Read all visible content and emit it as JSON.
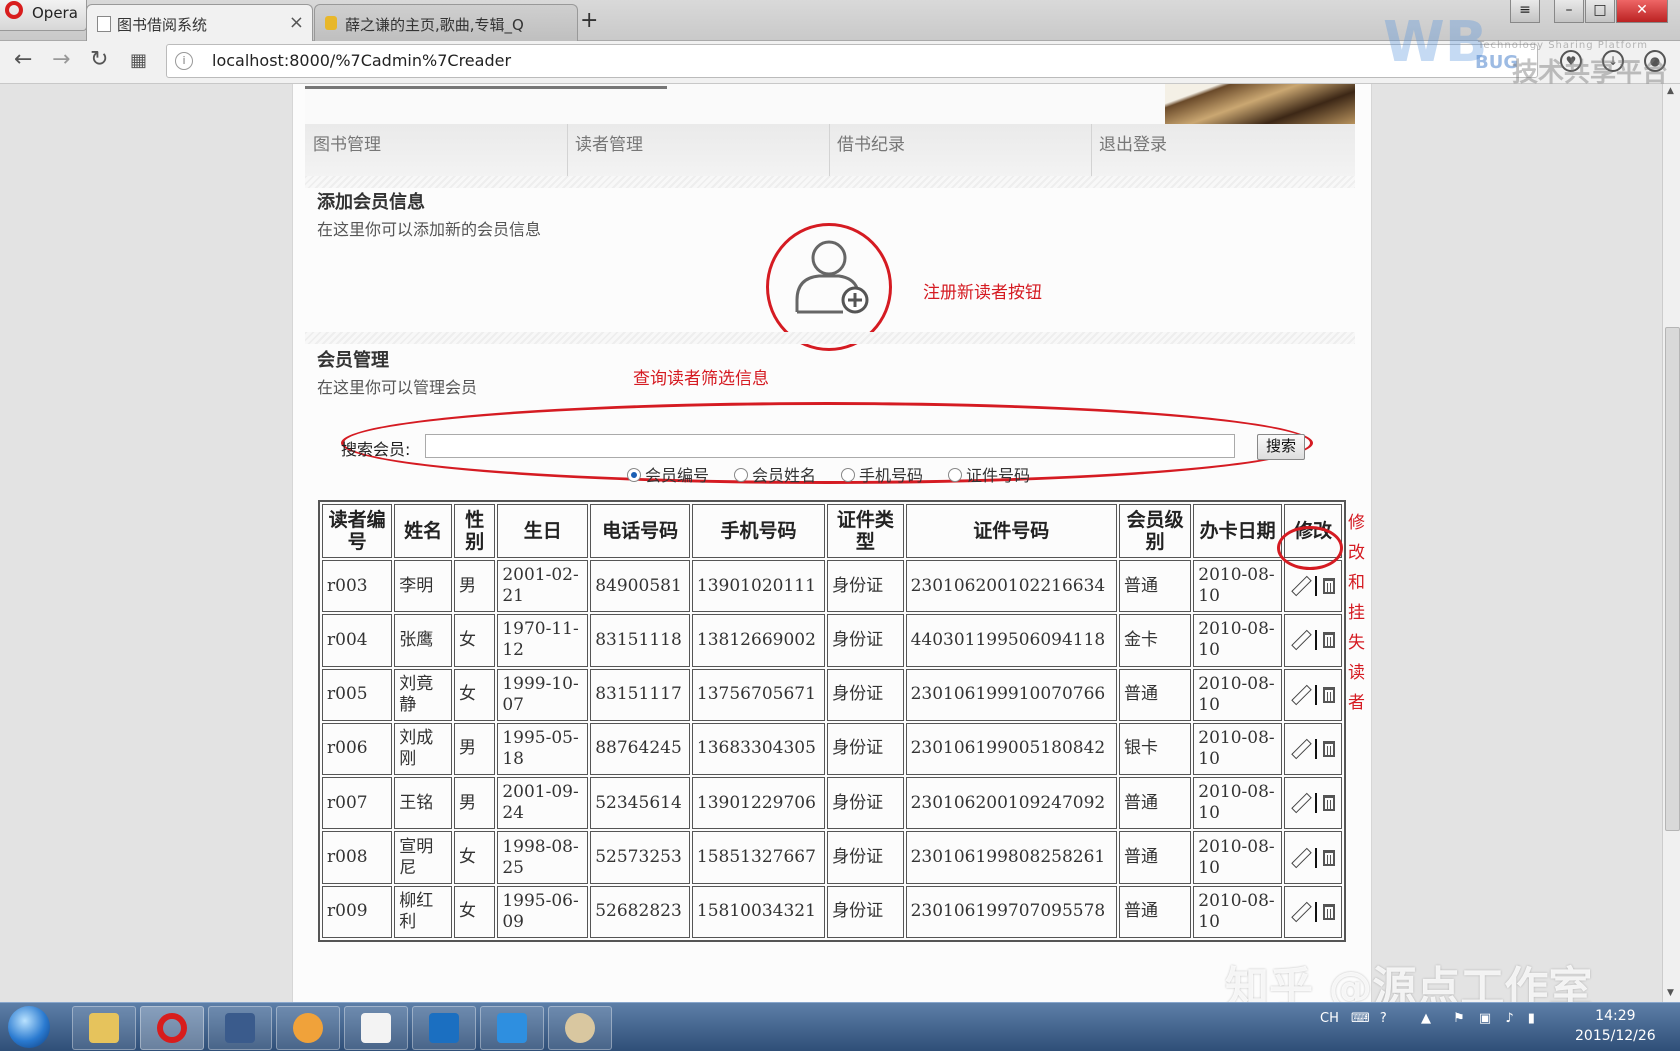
{
  "browser": {
    "menu_label": "Opera",
    "tabs": [
      {
        "title": "图书借阅系统",
        "active": true
      },
      {
        "title": "薛之谦的主页,歌曲,专辑_Q",
        "active": false
      }
    ],
    "new_tab": "+",
    "address": "localhost:8000/%7Cadmin%7Creader",
    "watermark_brand": {
      "logo": "WB",
      "bug": "BUG",
      "subtitle": "Technology Sharing Platform",
      "text": "技术共享平台"
    }
  },
  "nav_menu": [
    "图书管理",
    "读者管理",
    "借书纪录",
    "退出登录"
  ],
  "add_section": {
    "title": "添加会员信息",
    "desc": "在这里你可以添加新的会员信息"
  },
  "manage_section": {
    "title": "会员管理",
    "desc": "在这里你可以管理会员"
  },
  "search": {
    "label": "搜索会员:",
    "value": "",
    "button": "搜索",
    "options": [
      "会员编号",
      "会员姓名",
      "手机号码",
      "证件号码"
    ],
    "selected": "会员编号"
  },
  "annotations": {
    "register": "注册新读者按钮",
    "query": "查询读者筛选信息",
    "modify": [
      "修改和",
      "挂失读",
      "者"
    ],
    "color": "#d51b22"
  },
  "table": {
    "headers": [
      "读者编号",
      "姓名",
      "性别",
      "生日",
      "电话号码",
      "手机号码",
      "证件类型",
      "证件号码",
      "会员级别",
      "办卡日期",
      "修改"
    ],
    "rows": [
      [
        "r003",
        "李明",
        "男",
        "2001-02-21",
        "84900581",
        "13901020111",
        "身份证",
        "230106200102216634",
        "普通",
        "2010-08-10"
      ],
      [
        "r004",
        "张鹰",
        "女",
        "1970-11-12",
        "83151118",
        "13812669002",
        "身份证",
        "440301199506094118",
        "金卡",
        "2010-08-10"
      ],
      [
        "r005",
        "刘竟静",
        "女",
        "1999-10-07",
        "83151117",
        "13756705671",
        "身份证",
        "230106199910070766",
        "普通",
        "2010-08-10"
      ],
      [
        "r006",
        "刘成刚",
        "男",
        "1995-05-18",
        "88764245",
        "13683304305",
        "身份证",
        "230106199005180842",
        "银卡",
        "2010-08-10"
      ],
      [
        "r007",
        "王铭",
        "男",
        "2001-09-24",
        "52345614",
        "13901229706",
        "身份证",
        "230106200109247092",
        "普通",
        "2010-08-10"
      ],
      [
        "r008",
        "宣明尼",
        "女",
        "1998-08-25",
        "52573253",
        "15851327667",
        "身份证",
        "230106199808258261",
        "普通",
        "2010-08-10"
      ],
      [
        "r009",
        "柳红利",
        "女",
        "1995-06-09",
        "52682823",
        "15810034321",
        "身份证",
        "230106199707095578",
        "普通",
        "2010-08-10"
      ]
    ]
  },
  "watermark": "知乎 @源点工作室",
  "taskbar": {
    "lang": "CH",
    "time": "14:29",
    "date": "2015/12/26"
  }
}
